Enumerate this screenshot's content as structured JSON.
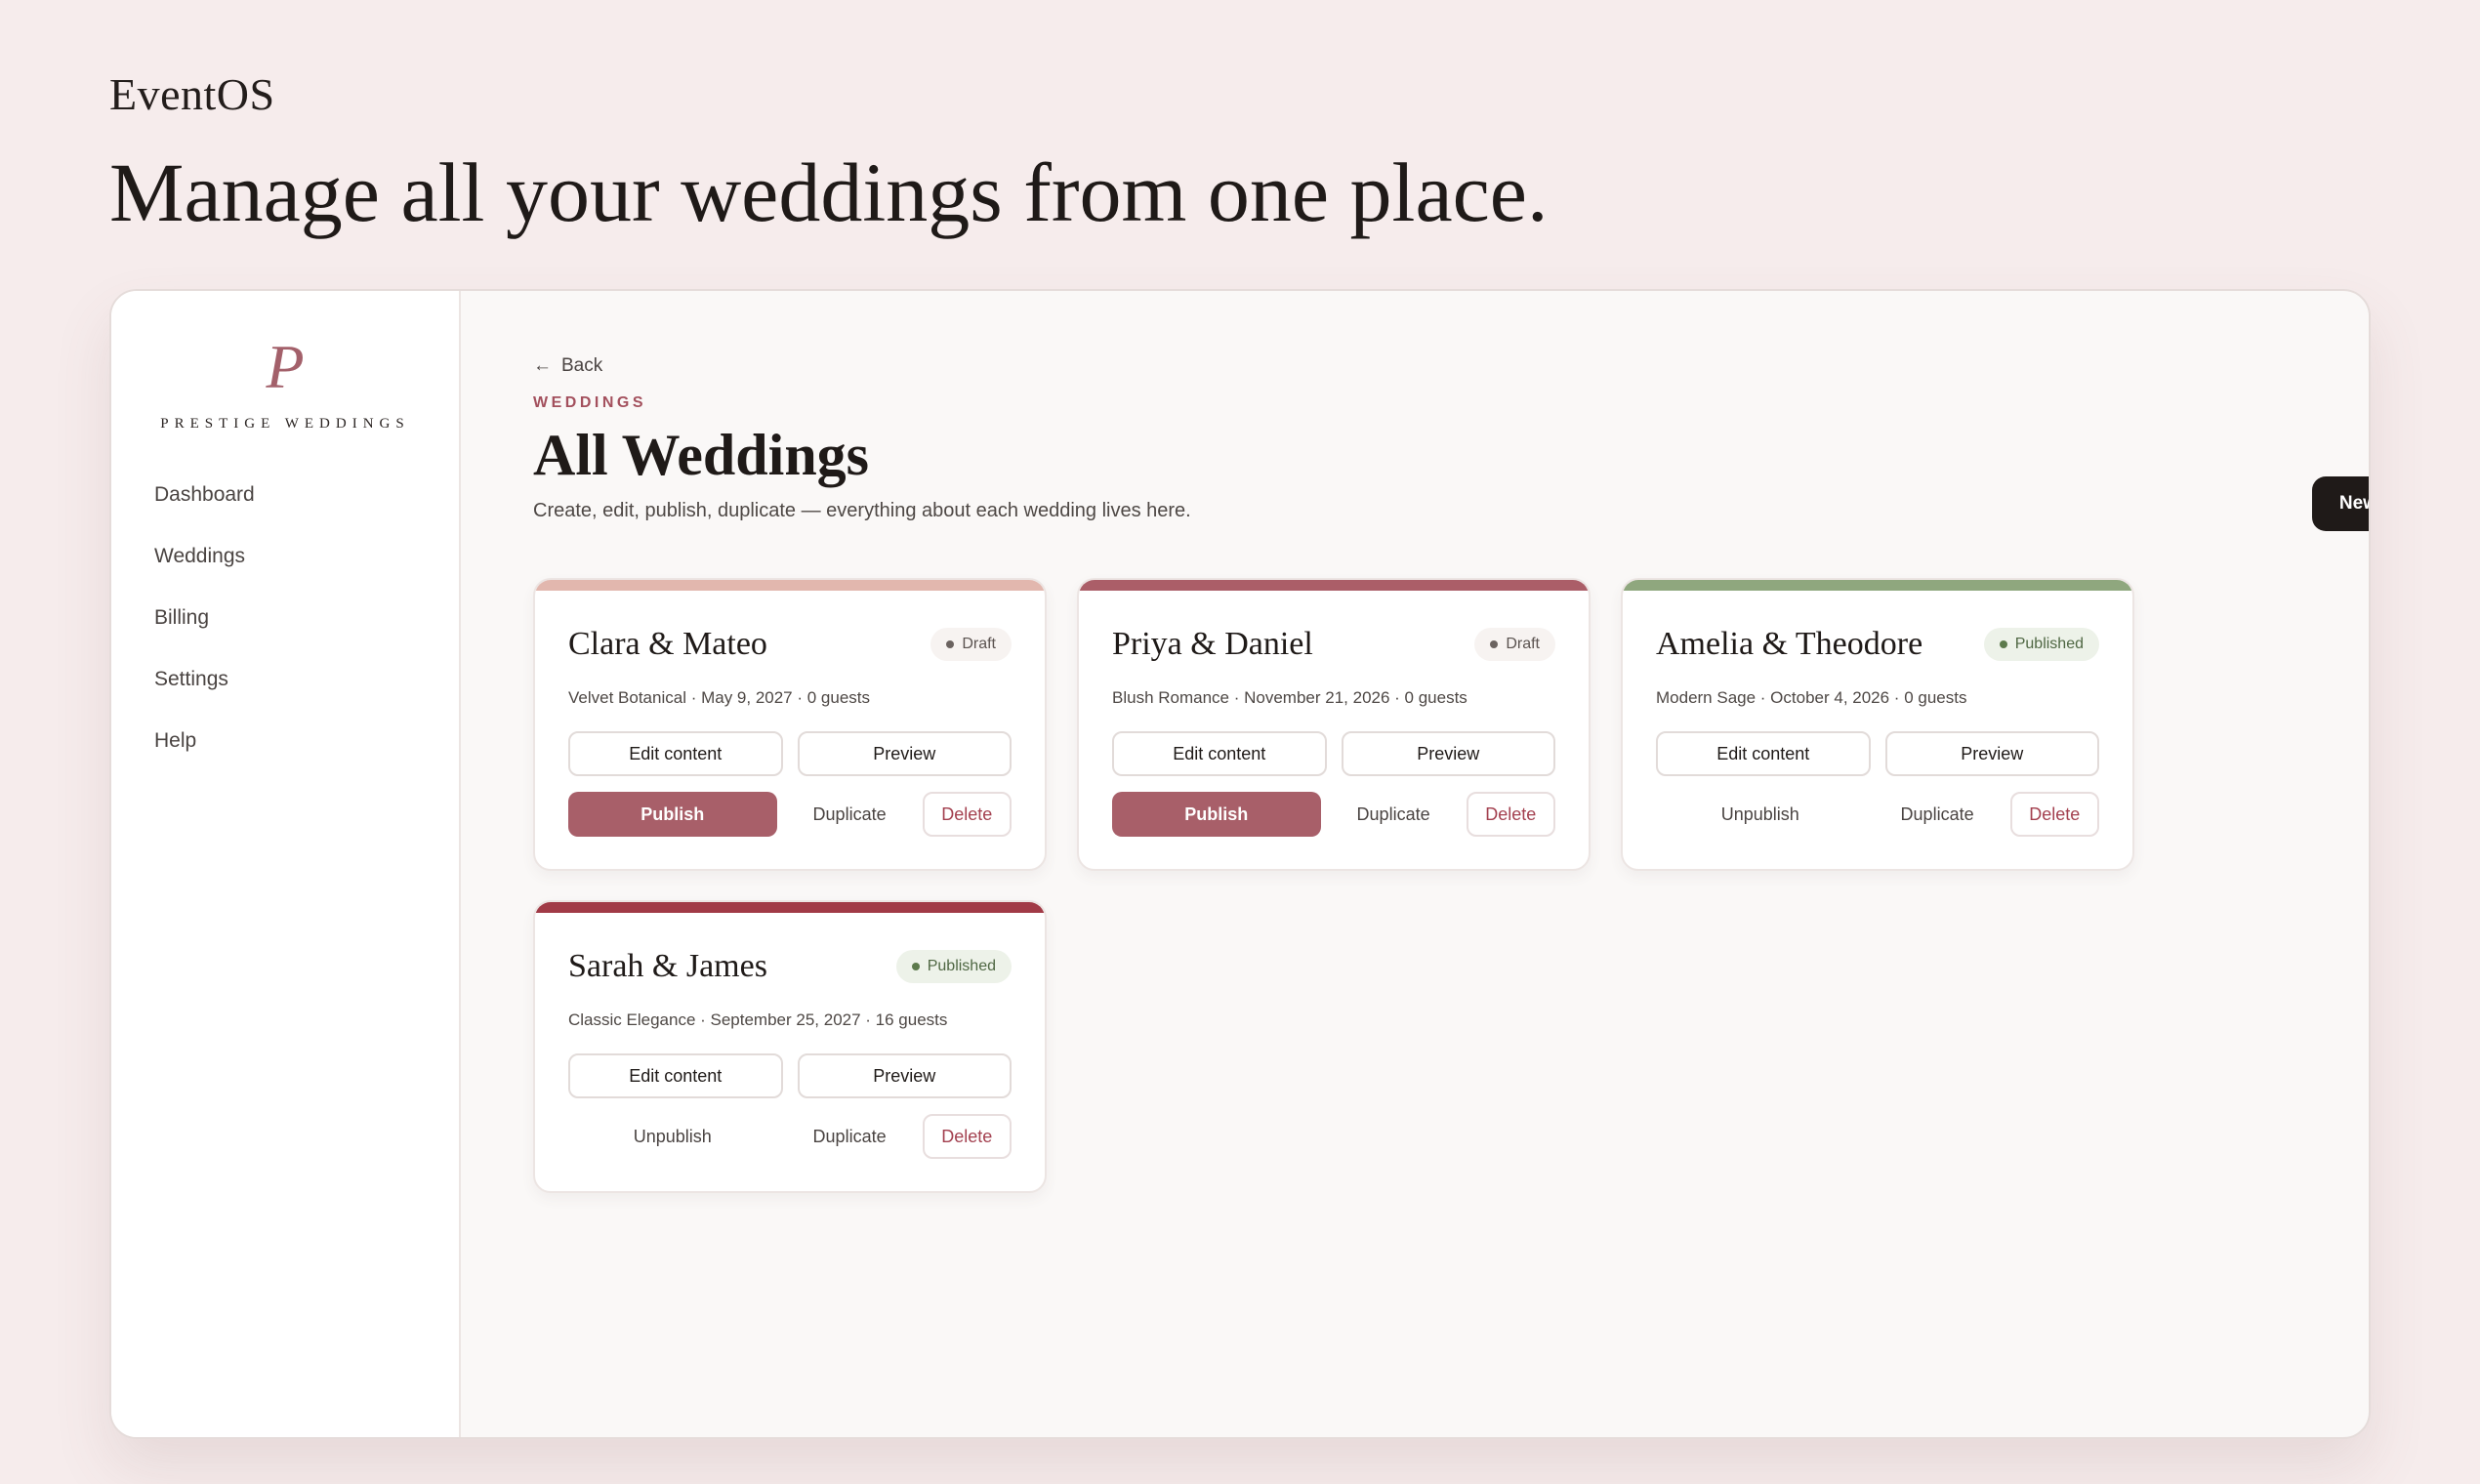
{
  "brand": "EventOS",
  "hero": "Manage all your weddings from one place.",
  "sidebar": {
    "logo_mark": "P",
    "logo_text": "PRESTIGE WEDDINGS",
    "items": [
      {
        "label": "Dashboard"
      },
      {
        "label": "Weddings"
      },
      {
        "label": "Billing"
      },
      {
        "label": "Settings"
      },
      {
        "label": "Help"
      }
    ]
  },
  "header": {
    "back_icon": "←",
    "back_label": "Back",
    "eyebrow": "WEDDINGS",
    "title": "All Weddings",
    "subtitle": "Create, edit, publish, duplicate — everything about each wedding lives here.",
    "new_button": "New Wedding"
  },
  "actions": {
    "edit": "Edit content",
    "preview": "Preview",
    "publish": "Publish",
    "unpublish": "Unpublish",
    "duplicate": "Duplicate",
    "delete": "Delete"
  },
  "weddings": [
    {
      "title": "Clara & Mateo",
      "status": "Draft",
      "meta": "Velvet Botanical · May 9, 2027 · 0 guests",
      "accent": "#e2b7ae"
    },
    {
      "title": "Priya & Daniel",
      "status": "Draft",
      "meta": "Blush Romance · November 21, 2026 · 0 guests",
      "accent": "#ab5e68"
    },
    {
      "title": "Amelia & Theodore",
      "status": "Published",
      "meta": "Modern Sage · October 4, 2026 · 0 guests",
      "accent": "#8fa77e"
    },
    {
      "title": "Sarah & James",
      "status": "Published",
      "meta": "Classic Elegance · September 25, 2027 · 16 guests",
      "accent": "#a13a46"
    }
  ],
  "colors": {
    "primary_action": "#a85f69",
    "dark_button": "#1f1a18",
    "delete_text": "#a3404f",
    "published_badge": "#edf2e9"
  }
}
